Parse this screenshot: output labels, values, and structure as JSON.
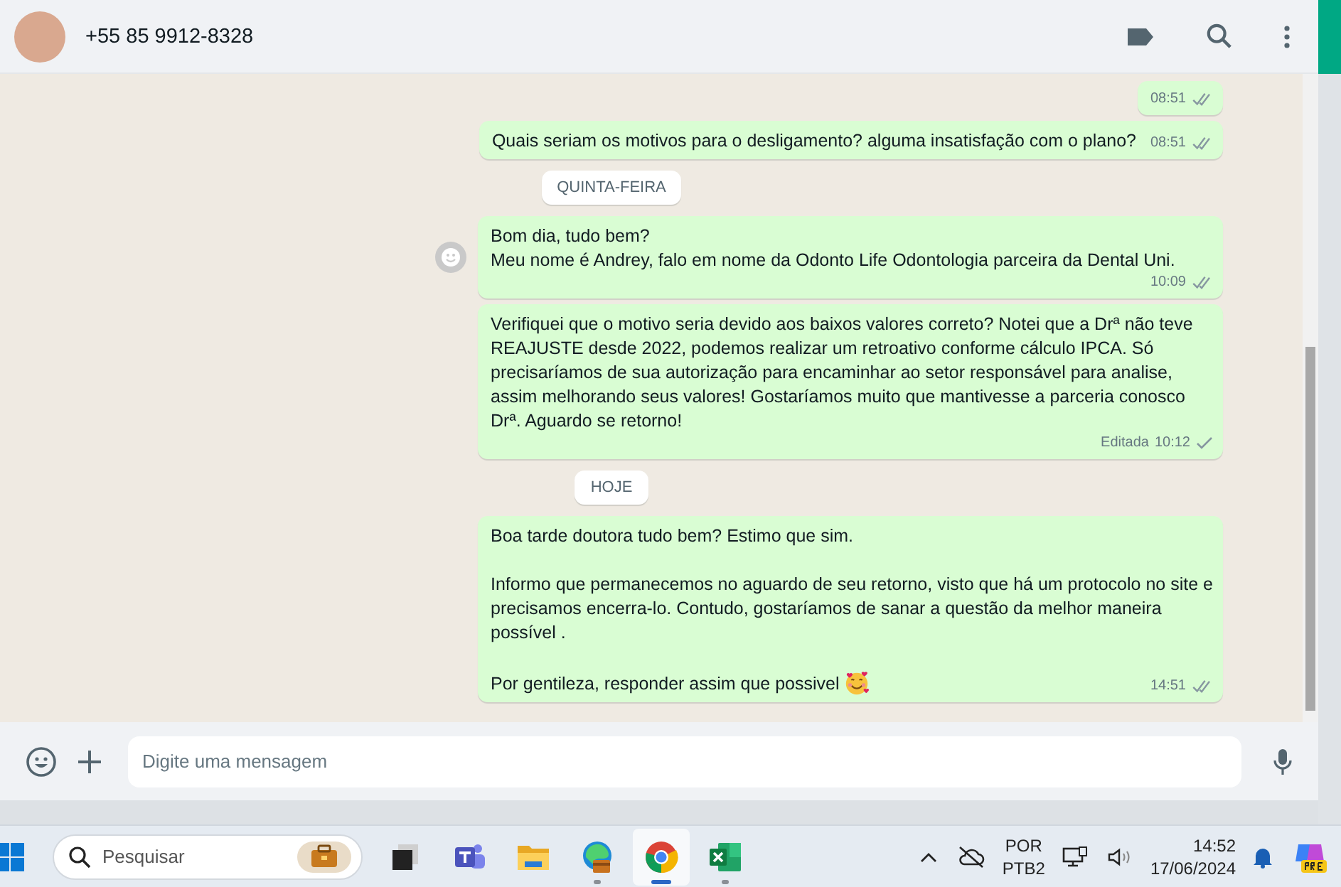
{
  "header": {
    "contact": "+55 85 9912-8328"
  },
  "timeline": [
    {
      "kind": "message",
      "time": "08:51",
      "delivered": true
    },
    {
      "kind": "message",
      "paragraphs": [
        "Quais seriam os motivos para o desligamento? alguma insatisfação com o plano?"
      ],
      "time": "08:51",
      "delivered": true
    },
    {
      "kind": "date",
      "text": "QUINTA-FEIRA"
    },
    {
      "kind": "message",
      "paragraphs": [
        "Bom dia, tudo bem?\nMeu nome é Andrey, falo em nome da Odonto Life Odontologia parceira da Dental Uni."
      ],
      "time": "10:09",
      "delivered": true,
      "reaction_button": true
    },
    {
      "kind": "message",
      "paragraphs": [
        "Verifiquei que o motivo seria devido aos baixos valores correto? Notei que a Drª não teve REAJUSTE desde 2022, podemos realizar um retroativo conforme cálculo IPCA. Só precisaríamos de sua autorização para encaminhar ao setor responsável para analise, assim melhorando seus valores! Gostaríamos muito que mantivesse a parceria conosco Drª. Aguardo se retorno!"
      ],
      "time": "10:12",
      "delivered": false,
      "edited": "Editada"
    },
    {
      "kind": "date",
      "text": "HOJE"
    },
    {
      "kind": "message",
      "paragraphs": [
        "Boa tarde doutora tudo bem? Estimo que sim.",
        "Informo que permanecemos no aguardo de seu retorno, visto que há um protocolo no site e precisamos encerra-lo. Contudo, gostaríamos de sanar a questão da melhor maneira possível .",
        "Por gentileza, responder assim que possivel"
      ],
      "trailing_emoji": true,
      "time": "14:51",
      "delivered": true
    }
  ],
  "composer": {
    "placeholder": "Digite uma mensagem"
  },
  "taskbar": {
    "search_placeholder": "Pesquisar",
    "apps": [
      {
        "kind": "task-view",
        "running": false,
        "selected": false
      },
      {
        "kind": "teams",
        "running": false,
        "selected": false
      },
      {
        "kind": "files",
        "running": false,
        "selected": false
      },
      {
        "kind": "edge",
        "running": true,
        "selected": false
      },
      {
        "kind": "chrome",
        "running": true,
        "selected": true
      },
      {
        "kind": "excel",
        "running": true,
        "selected": false
      }
    ],
    "language": "POR",
    "layout": "PTB2",
    "time": "14:52",
    "date": "17/06/2024"
  }
}
